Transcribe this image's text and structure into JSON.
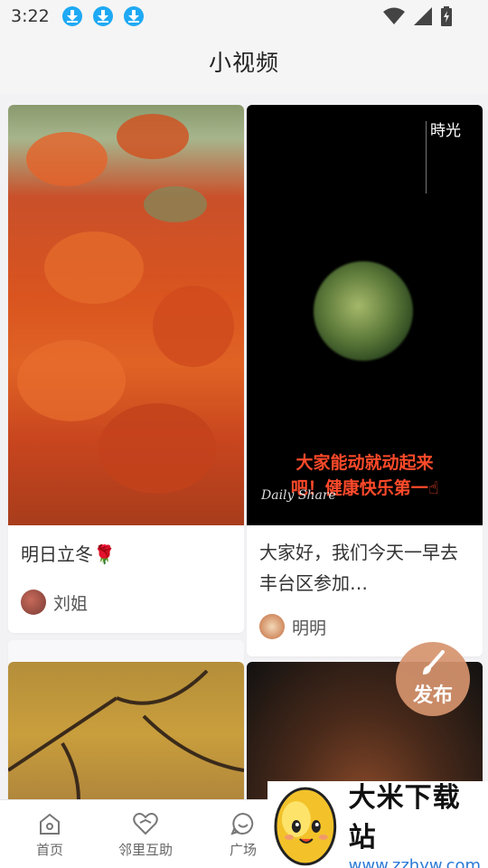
{
  "status": {
    "time": "3:22"
  },
  "header": {
    "title": "小视频"
  },
  "cards": [
    {
      "text": "明日立冬🌹",
      "author": "刘姐"
    },
    {
      "text": "大家好，我们今天一早去丰台区参加…",
      "author": "明明",
      "overlay_top_right": "時光",
      "overlay_caption_line1": "大家能动就动起来",
      "overlay_caption_line2": "吧！健康快乐第一☝",
      "overlay_script": "Daily Share"
    }
  ],
  "fab": {
    "label": "发布",
    "icon": "brush-icon"
  },
  "tabs": [
    {
      "label": "首页",
      "icon": "home-icon"
    },
    {
      "label": "邻里互助",
      "icon": "heart-icon"
    },
    {
      "label": "广场",
      "icon": "smile-icon"
    }
  ],
  "watermark": {
    "title": "大米下载站",
    "url": "www.zzhyw.com"
  },
  "colors": {
    "accent": "#1fa9f4",
    "fab": "#d6946e"
  }
}
